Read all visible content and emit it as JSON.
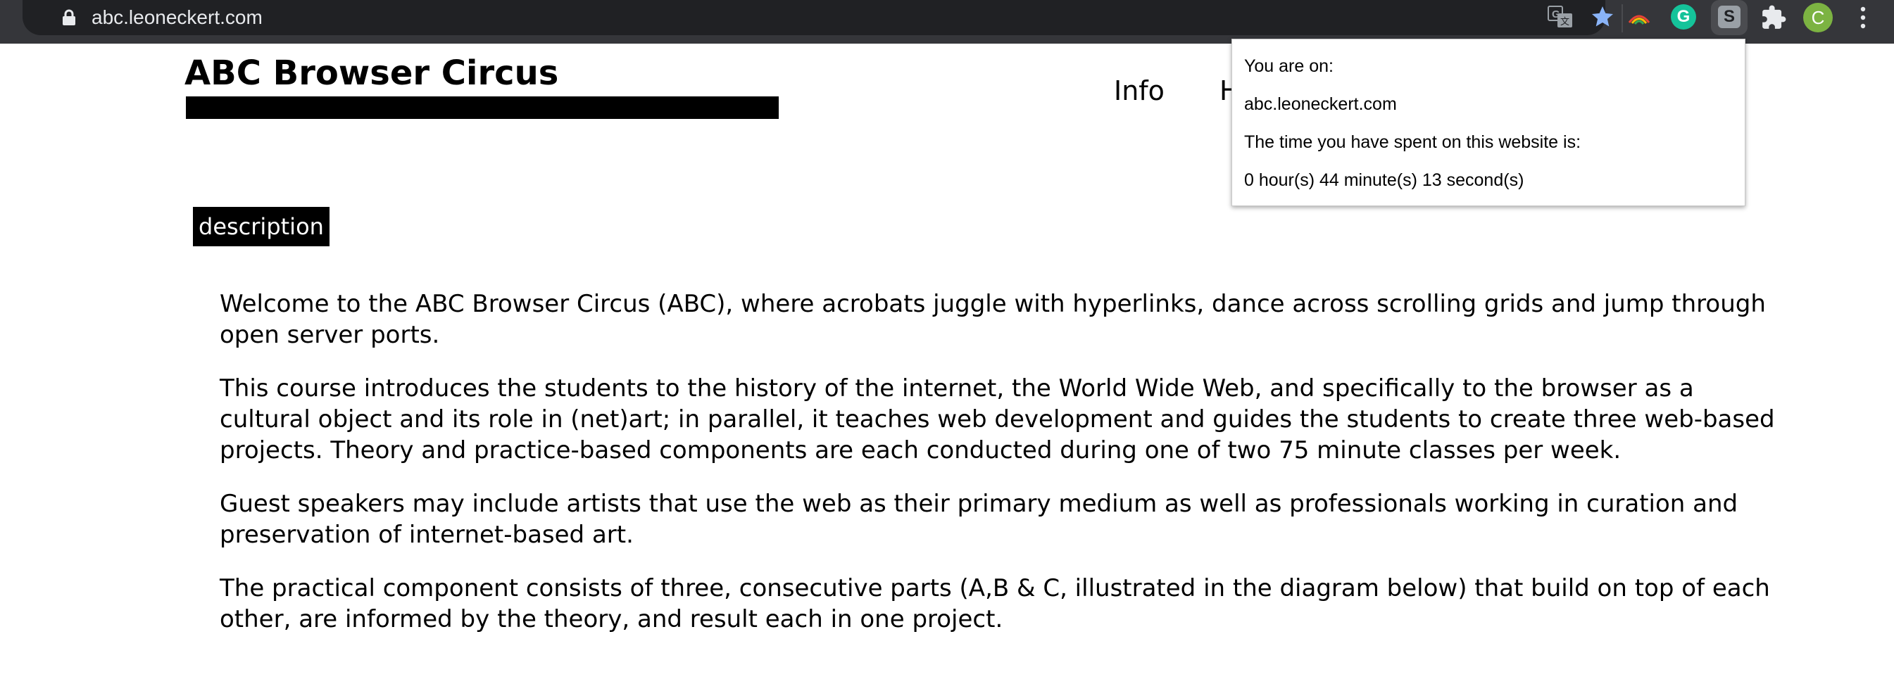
{
  "browser": {
    "url": "abc.leoneckert.com",
    "avatar_letter": "C",
    "extensions": [
      {
        "name": "google-translate-icon"
      },
      {
        "name": "bookmark-star-icon"
      },
      {
        "name": "rainbow-extension-icon"
      },
      {
        "name": "grammarly-icon",
        "label": "G"
      },
      {
        "name": "time-tracker-extension-icon",
        "label": "S"
      },
      {
        "name": "extensions-puzzle-icon"
      }
    ],
    "colors": {
      "toolbar": "#35363a",
      "omnibox": "#202124",
      "accent_star": "#8ab4f8"
    }
  },
  "site": {
    "title": "ABC Browser Circus",
    "nav": {
      "info": "Info",
      "second_partial": "H"
    },
    "badge": "description",
    "paragraphs": [
      "Welcome to the ABC Browser Circus (ABC), where acrobats juggle with hyperlinks, dance across scrolling grids and jump through open server ports.",
      "This course introduces the students to the history of the internet, the World Wide Web, and specifically to the browser as a cultural object and its role in (net)art; in parallel, it teaches web development and guides the students to create three web-based projects. Theory and practice-based components are each conducted during one of two 75 minute classes per week.",
      "Guest speakers may include artists that use the web as their primary medium as well as professionals working in curation and preservation of internet-based art.",
      "The practical component consists of three, consecutive parts (A,B & C, illustrated in the diagram below) that build on top of each other, are informed by the theory, and result each in one project."
    ]
  },
  "popup": {
    "line1": "You are on:",
    "line2": "abc.leoneckert.com",
    "line3": "The time you have spent on this website is:",
    "line4": "0 hour(s) 44 minute(s) 13 second(s)"
  }
}
